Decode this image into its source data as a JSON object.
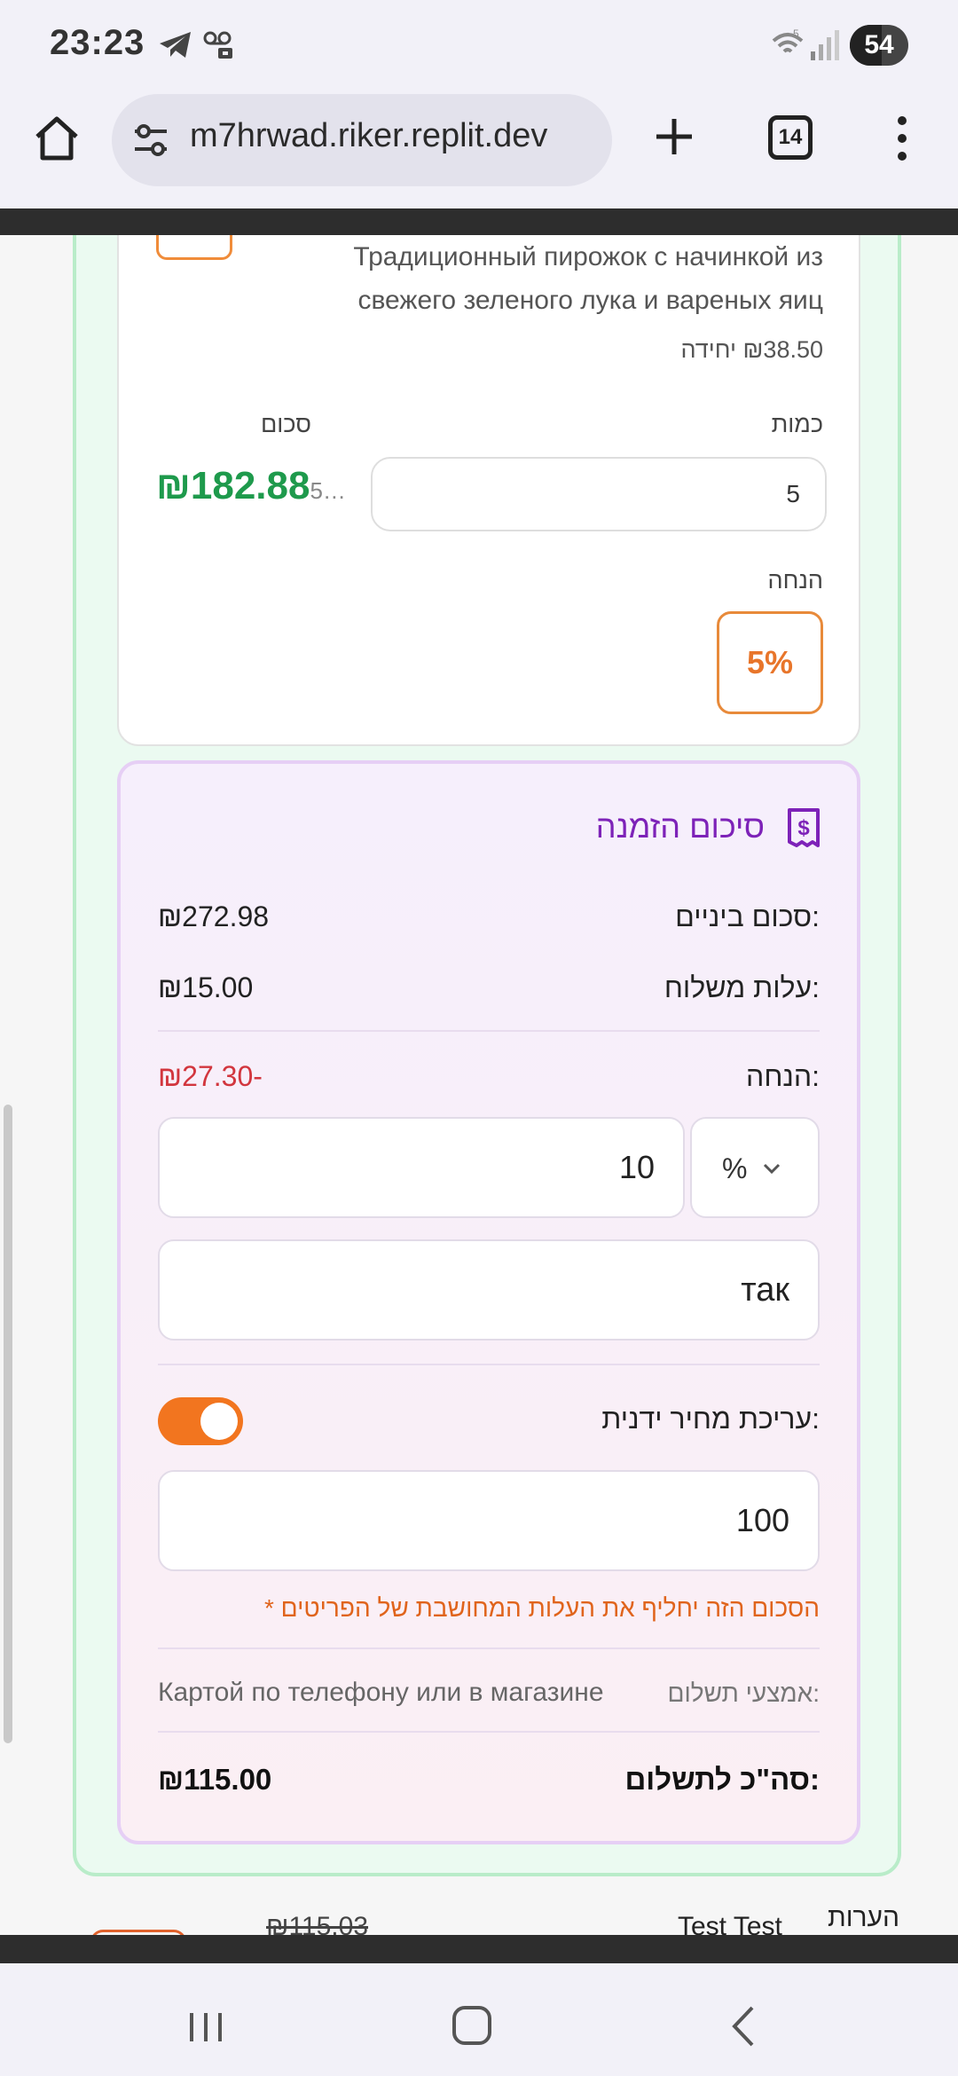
{
  "status_bar": {
    "time": "23:23",
    "battery": "54",
    "battery_level_percent": 54,
    "wifi_badge": "5"
  },
  "browser": {
    "url": "m7hrwad.riker.replit.dev",
    "tab_count": "14",
    "icons": [
      "home-icon",
      "tune-icon",
      "plus-icon",
      "tabs-icon",
      "more-vert-icon"
    ]
  },
  "item": {
    "description": "Традиционный пирожок с начинкой из свежего зеленого лука и вареных яиц",
    "unit_price": "₪38.50 יחידה",
    "qty_label": "כמות",
    "qty_value": "5",
    "sum_label": "סכום",
    "sum_truncated": "5…",
    "sum_value": "₪182.88",
    "discount_label": "הנחה",
    "discount_value": "5%"
  },
  "summary": {
    "title": "סיכום הזמנה",
    "subtotal_label": "סכום ביניים:",
    "subtotal_value": "₪272.98",
    "shipping_label": "עלות משלוח:",
    "shipping_value": "₪15.00",
    "discount_label": "הנחה:",
    "discount_value": "₪27.30-",
    "discount_unit": "%",
    "discount_input": "10",
    "discount_reason": "так",
    "manual_label": "עריכת מחיר ידנית:",
    "manual_enabled": true,
    "manual_value": "100",
    "manual_note": "* הסכום הזה יחליף את העלות המחושבת של הפריטים",
    "payment_label": "אמצעי תשלום:",
    "payment_value": "Картой по телефону или в магазине",
    "total_label": "סה\"כ לתשלום:",
    "total_value": "₪115.00"
  },
  "next_order": {
    "label": "הערות",
    "name": "Test Test",
    "price": "₪115.03"
  },
  "colors": {
    "accent_orange": "#f2751f",
    "total_green": "#1e9a4c",
    "discount_red": "#d2363e",
    "title_purple": "#7d22b8"
  }
}
